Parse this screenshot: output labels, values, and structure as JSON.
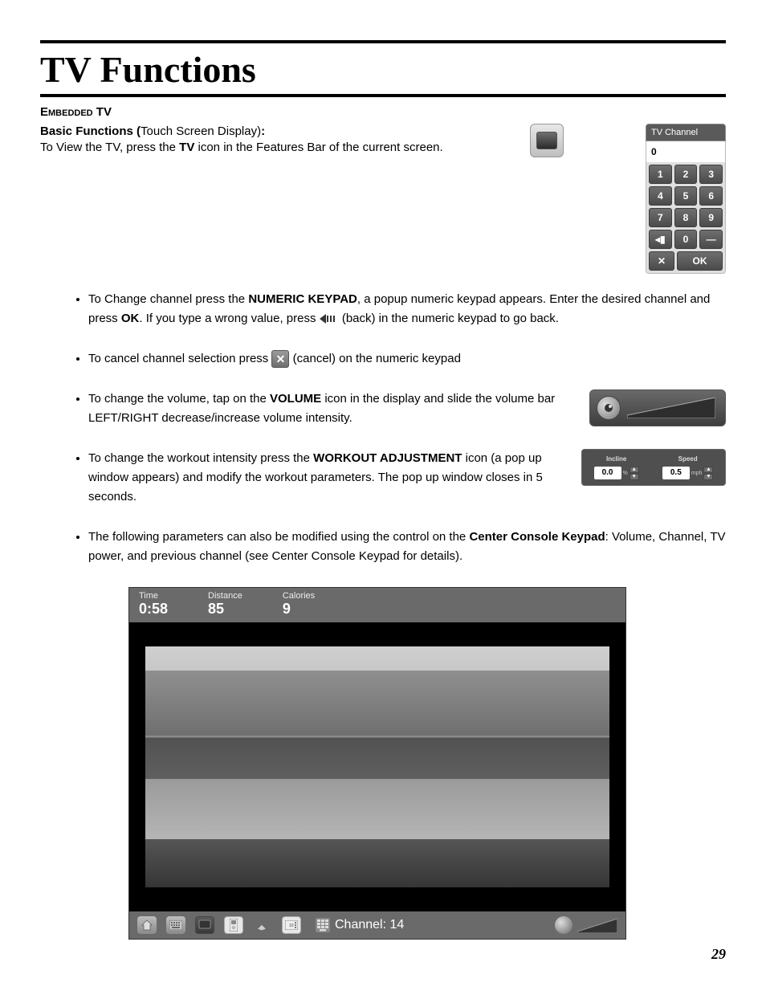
{
  "title": "TV Functions",
  "section_label": "Embedded TV",
  "intro": {
    "bold1": "Basic Functions (",
    "plain1": "Touch Screen Display)",
    "bold2": ":",
    "line2a": "To View the TV,  press the ",
    "line2_bold": "TV",
    "line2b": " icon in the Features Bar of the current screen."
  },
  "bullets": {
    "b1a": "To Change channel press the ",
    "b1_bold1": "NUMERIC KEYPAD",
    "b1b": ", a popup numeric keypad appears. Enter the desired channel and press ",
    "b1_bold2": "OK",
    "b1c": ". If you type a wrong value, press ",
    "b1d": " (back) in the numeric keypad to go back.",
    "b2a": "To  cancel  channel  selection  press ",
    "b2b": " (cancel) on the numeric keypad",
    "b3a": "To change the volume,  tap on the ",
    "b3_bold": "VOLUME",
    "b3b": " icon in the display and slide the volume bar LEFT/RIGHT decrease/increase volume intensity.",
    "b4a": "To change the workout intensity press the ",
    "b4_bold": "WORKOUT ADJUSTMENT",
    "b4b": " icon (a pop up window appears) and modify the workout parameters. The pop up window closes in 5 seconds.",
    "b5a": "The following parameters can also be modified using the control on the ",
    "b5_bold": "Center  Console  Keypad",
    "b5b": ": Volume, Channel, TV power, and previous channel (see Center Console Keypad for details)."
  },
  "keypad": {
    "header": "TV Channel",
    "display": "0",
    "keys": [
      "1",
      "2",
      "3",
      "4",
      "5",
      "6",
      "7",
      "8",
      "9",
      "◂▮",
      "0",
      "—"
    ],
    "cancel": "✕",
    "ok": "OK"
  },
  "workout": {
    "incline_label": "Incline",
    "incline_value": "0.0",
    "incline_unit": "%",
    "speed_label": "Speed",
    "speed_value": "0.5",
    "speed_unit": "mph"
  },
  "tv": {
    "stats": {
      "time_label": "Time",
      "time_value": "0:58",
      "distance_label": "Distance",
      "distance_value": "85",
      "calories_label": "Calories",
      "calories_value": "9"
    },
    "channel_label": "Channel: 14"
  },
  "page_number": "29"
}
